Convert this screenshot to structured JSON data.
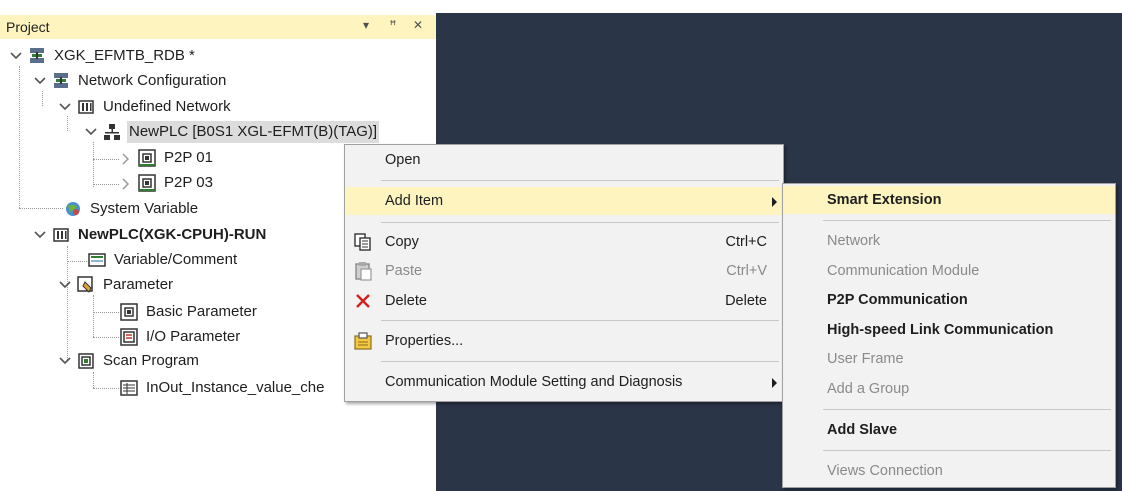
{
  "panel": {
    "title": "Project",
    "buttons": {
      "dropdown": "▾",
      "pin": "ꟸ",
      "close": "✕"
    }
  },
  "tree": {
    "project": "XGK_EFMTB_RDB *",
    "network_configuration": "Network Configuration",
    "undefined_network": "Undefined Network",
    "newplc_node": "NewPLC [B0S1 XGL-EFMT(B)(TAG)]",
    "p2p_01": "P2P 01",
    "p2p_03": "P2P 03",
    "system_variable": "System Variable",
    "plc": "NewPLC(XGK-CPUH)-RUN",
    "variable_comment": "Variable/Comment",
    "parameter": "Parameter",
    "basic_parameter": "Basic Parameter",
    "io_parameter": "I/O Parameter",
    "scan_program": "Scan Program",
    "inout_instance": "InOut_Instance_value_che"
  },
  "context_menu": {
    "open": "Open",
    "add_item": "Add Item",
    "copy": "Copy",
    "copy_shortcut": "Ctrl+C",
    "paste": "Paste",
    "paste_shortcut": "Ctrl+V",
    "delete": "Delete",
    "delete_shortcut": "Delete",
    "properties": "Properties...",
    "comm_module_setting": "Communication Module Setting and Diagnosis"
  },
  "submenu": {
    "smart_extension": "Smart Extension",
    "network": "Network",
    "communication_module": "Communication Module",
    "p2p_communication": "P2P Communication",
    "high_speed_link": "High-speed Link Communication",
    "user_frame": "User Frame",
    "add_group": "Add a Group",
    "add_slave": "Add Slave",
    "views_connection": "Views Connection"
  },
  "colors": {
    "header_bg": "#fdf4bf",
    "highlight": "#fdf4bf",
    "dock_bg": "#2b3548",
    "menu_bg": "#f2f2f2",
    "disabled_text": "#8a8a8a"
  }
}
